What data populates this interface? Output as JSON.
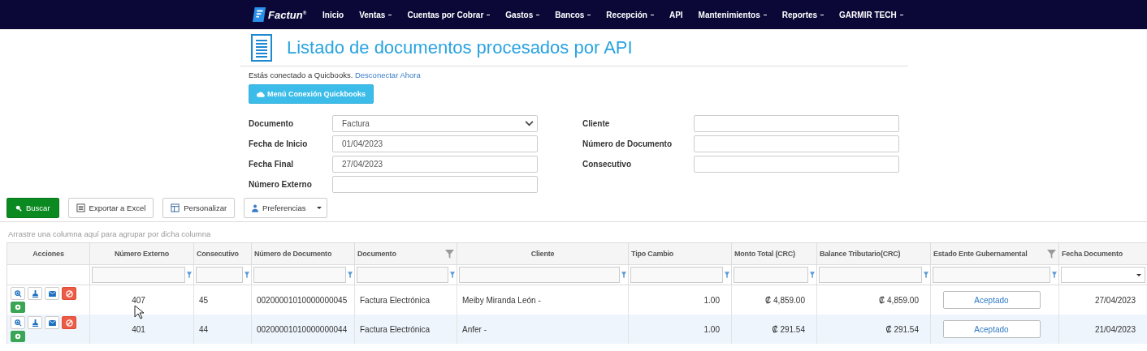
{
  "nav": {
    "brand": "Factun",
    "brand_mark": "®",
    "items": [
      {
        "label": "Inicio",
        "dropdown": false
      },
      {
        "label": "Ventas",
        "dropdown": true
      },
      {
        "label": "Cuentas por Cobrar",
        "dropdown": true
      },
      {
        "label": "Gastos",
        "dropdown": true
      },
      {
        "label": "Bancos",
        "dropdown": true
      },
      {
        "label": "Recepción",
        "dropdown": true
      },
      {
        "label": "API",
        "dropdown": false
      },
      {
        "label": "Mantenimientos",
        "dropdown": true
      },
      {
        "label": "Reportes",
        "dropdown": true
      },
      {
        "label": "GARMIR TECH",
        "dropdown": true
      }
    ]
  },
  "page": {
    "title": "Listado de documentos procesados por API",
    "status_text": "Estás conectado a Quicbooks.",
    "status_link": "Desconectar Ahora",
    "connect_button": "Menú Conexión Quickbooks"
  },
  "filters": {
    "left": [
      {
        "label": "Documento",
        "kind": "select",
        "value": "Factura"
      },
      {
        "label": "Fecha de Inicio",
        "kind": "text",
        "value": "01/04/2023"
      },
      {
        "label": "Fecha Final",
        "kind": "text",
        "value": "27/04/2023"
      },
      {
        "label": "Número Externo",
        "kind": "text"
      }
    ],
    "right": [
      {
        "label": "Cliente",
        "kind": "text"
      },
      {
        "label": "Número de Documento",
        "kind": "text"
      },
      {
        "label": "Consecutivo",
        "kind": "text"
      }
    ]
  },
  "toolbar": {
    "search": "Buscar",
    "export": "Exportar a Excel",
    "customize": "Personalizar",
    "preferences": "Preferencias"
  },
  "group_hint": "Arrastre una columna aquí para agrupar por dicha columna",
  "table": {
    "columns": [
      {
        "label": "Acciones",
        "kind": "none",
        "menu": false
      },
      {
        "label": "Número Externo",
        "kind": "text",
        "menu": false
      },
      {
        "label": "Consecutivo",
        "kind": "text",
        "menu": false
      },
      {
        "label": "Número de Documento",
        "kind": "text",
        "menu": false
      },
      {
        "label": "Documento",
        "kind": "text",
        "menu": true
      },
      {
        "label": "Cliente",
        "kind": "text",
        "menu": false
      },
      {
        "label": "Tipo Cambio",
        "kind": "text",
        "menu": false
      },
      {
        "label": "Monto Total (CRC)",
        "kind": "text",
        "menu": false
      },
      {
        "label": "Balance Tributario(CRC)",
        "kind": "text",
        "menu": false
      },
      {
        "label": "Estado Ente Gubernamental",
        "kind": "text",
        "menu": true
      },
      {
        "label": "Fecha Documento",
        "kind": "select",
        "menu": false
      }
    ],
    "rows": [
      {
        "selected": false,
        "cells": [
          "",
          "407",
          "45",
          "00200001010000000045",
          "Factura Electrónica",
          "Meiby Miranda León -",
          "1.00",
          "₡ 4,859.00",
          "₡ 4,859.00",
          "Aceptado",
          "27/04/2023"
        ]
      },
      {
        "selected": true,
        "cells": [
          "",
          "401",
          "44",
          "00200001010000000044",
          "Factura Electrónica",
          "Anfer -",
          "1.00",
          "₡ 291.54",
          "₡ 291.54",
          "Aceptado",
          "21/04/2023"
        ]
      }
    ]
  }
}
